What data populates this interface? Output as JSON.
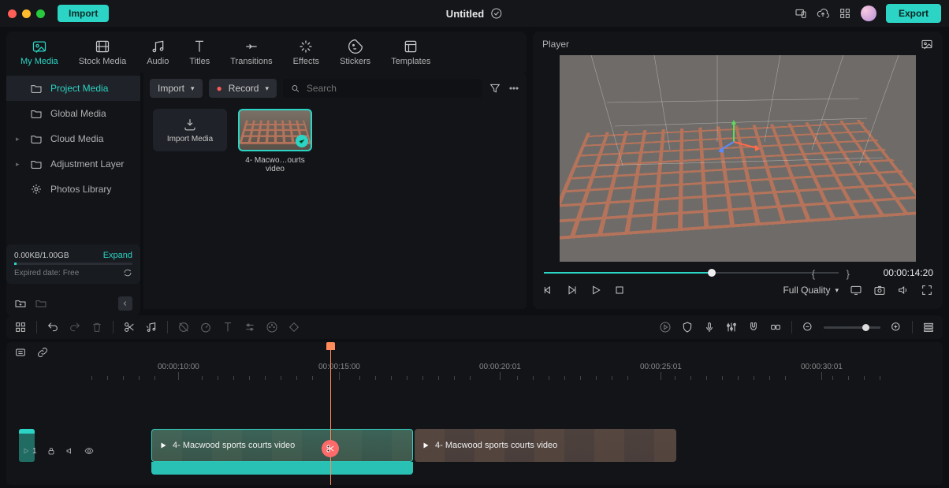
{
  "titlebar": {
    "import_btn": "Import",
    "title": "Untitled",
    "export_btn": "Export"
  },
  "main_tabs": [
    {
      "label": "My Media",
      "active": true
    },
    {
      "label": "Stock Media"
    },
    {
      "label": "Audio"
    },
    {
      "label": "Titles"
    },
    {
      "label": "Transitions"
    },
    {
      "label": "Effects"
    },
    {
      "label": "Stickers"
    },
    {
      "label": "Templates"
    }
  ],
  "side_items": [
    {
      "label": "Project Media",
      "active": true,
      "expandable": false
    },
    {
      "label": "Global Media",
      "expandable": false
    },
    {
      "label": "Cloud Media",
      "expandable": true
    },
    {
      "label": "Adjustment Layer",
      "expandable": true
    },
    {
      "label": "Photos Library",
      "expandable": false
    }
  ],
  "storage": {
    "used": "0.00KB",
    "total": "1.00GB",
    "expand": "Expand",
    "expired_label": "Expired date:",
    "expired_value": "Free"
  },
  "media_top": {
    "import_dd": "Import",
    "record_dd": "Record",
    "search_placeholder": "Search"
  },
  "media_items": {
    "import_card": "Import Media",
    "clip1": "4- Macwo…ourts video"
  },
  "player": {
    "title": "Player",
    "timecode": "00:00:14:20",
    "quality": "Full Quality"
  },
  "ruler_labels": {
    "t10": "00:00:10:00",
    "t15": "00:00:15:00",
    "t20": "00:00:20:01",
    "t25": "00:00:25:01",
    "t30": "00:00:30:01"
  },
  "clips": {
    "a": "4- Macwood sports courts video",
    "b": "4- Macwood sports courts video"
  },
  "gutter": {
    "tracknum": "1"
  }
}
